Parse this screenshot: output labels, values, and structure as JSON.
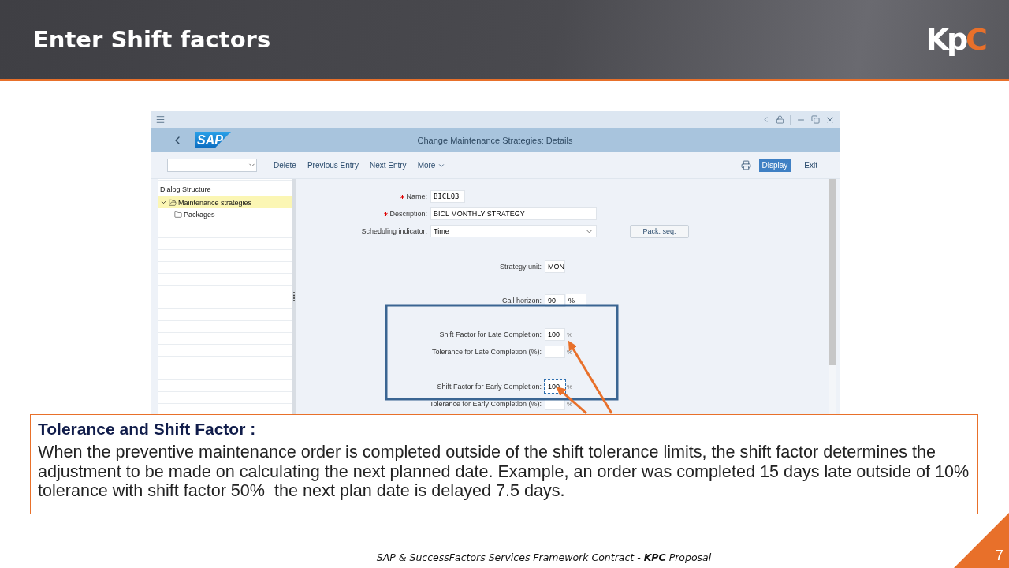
{
  "slide": {
    "title": "Enter Shift factors",
    "logo": [
      {
        "text": "Kp",
        "color": "#ffffff"
      },
      {
        "text": "C",
        "color": "#e8702a"
      }
    ],
    "page_number": "7",
    "footer": "SAP & SuccessFactors Services Framework Contract - **KPC** Proposal"
  },
  "window": {
    "logo": "SAP",
    "title": "Change Maintenance Strategies: Details",
    "toolbar": {
      "left": [
        "Delete",
        "Previous Entry",
        "Next Entry"
      ],
      "more": "More",
      "display": {
        "label": "Display",
        "selected": true
      },
      "exit": "Exit"
    },
    "dialog_structure": {
      "title": "Dialog Structure",
      "items": [
        {
          "label": "Maintenance strategies",
          "expanded": true,
          "selected": true,
          "children": [
            {
              "label": "Packages",
              "expanded": false,
              "selected": false
            }
          ]
        }
      ]
    },
    "form_groups": [
      [
        {
          "label": "Name:",
          "required": true,
          "kind": "short-input",
          "value": "BICL03",
          "focused": false
        },
        {
          "label": "Description:",
          "required": true,
          "kind": "long-input",
          "value": "BICL MONTHLY STRATEGY",
          "focused": false
        },
        {
          "label": "Scheduling indicator:",
          "required": false,
          "kind": "select",
          "value": "Time",
          "focused": false,
          "button": "Pack. seq."
        }
      ],
      [
        {
          "label": "Strategy unit:",
          "required": false,
          "kind": "short-input",
          "value": "MON",
          "focused": false
        }
      ],
      [
        {
          "label": "Call horizon:",
          "required": false,
          "kind": "short-input",
          "value": "90",
          "focused": false,
          "unit": {
            "text": "%",
            "boxed": true
          }
        }
      ],
      [
        {
          "label": "Shift Factor for Late Completion:",
          "required": false,
          "kind": "short-input",
          "value": "100",
          "focused": false,
          "unit": {
            "text": "%",
            "boxed": false
          }
        },
        {
          "label": "Tolerance for Late Completion (%):",
          "required": false,
          "kind": "short-input",
          "focused": false,
          "unit": {
            "text": "%",
            "boxed": false
          }
        }
      ],
      [
        {
          "label": "Shift Factor for Early Completion:",
          "required": false,
          "kind": "short-input",
          "value": "100",
          "focused": true,
          "unit": {
            "text": "%",
            "boxed": false
          }
        },
        {
          "label": "Tolerance for Early Completion (%):",
          "required": false,
          "kind": "short-input",
          "focused": false,
          "unit": {
            "text": "%",
            "boxed": false
          }
        }
      ]
    ]
  },
  "callout": {
    "title": "Tolerance and Shift Factor :",
    "body": "When the preventive maintenance order is completed outside of the shift tolerance limits, the shift factor determines the adjustment to be made on calculating the next planned date. Example, an order was completed 15 days late outside of 10% tolerance with shift factor 50%  the next plan date is delayed 7.5 days."
  }
}
